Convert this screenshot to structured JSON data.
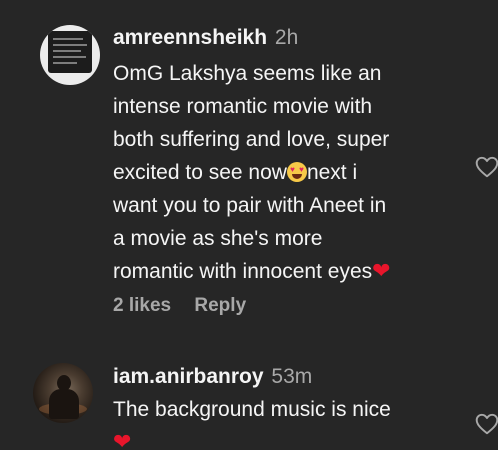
{
  "comments": [
    {
      "username": "amreennsheikh",
      "time": "2h",
      "text_lines": [
        "OmG Lakshya seems like an",
        "intense romantic movie with",
        "both suffering and love, super"
      ],
      "text_line4_before": "excited to see now",
      "text_line4_after": "next i",
      "text_lines_b": [
        "want you to pair with Aneet in",
        "a movie as she's more"
      ],
      "text_last": "romantic with innocent eyes",
      "emoji_1": "heart-eyes-emoji",
      "emoji_2": "red-heart-emoji",
      "likes": "2 likes",
      "reply_label": "Reply"
    },
    {
      "username": "iam.anirbanroy",
      "time": "53m",
      "text": "The background music is nice",
      "emoji_1": "red-heart-emoji"
    }
  ],
  "icons": {
    "like": "heart-outline-icon"
  },
  "colors": {
    "background": "#262626",
    "primary_text": "#f5f5f5",
    "secondary_text": "#a8a8a8",
    "heart_emoji": "#e8152b"
  }
}
